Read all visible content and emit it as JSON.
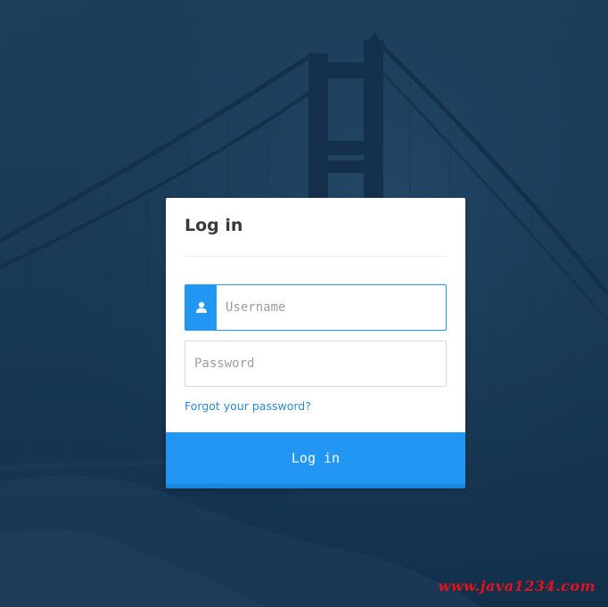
{
  "login": {
    "title": "Log in",
    "username_placeholder": "Username",
    "password_placeholder": "Password",
    "forgot_link": "Forgot your password?",
    "submit_label": "Log in",
    "user_icon": "user-icon"
  },
  "watermark": {
    "text": "www.java1234.com"
  },
  "colors": {
    "background": "#1c3b57",
    "accent": "#2196f3",
    "link": "#2a8ad8",
    "watermark": "#e0131e"
  }
}
